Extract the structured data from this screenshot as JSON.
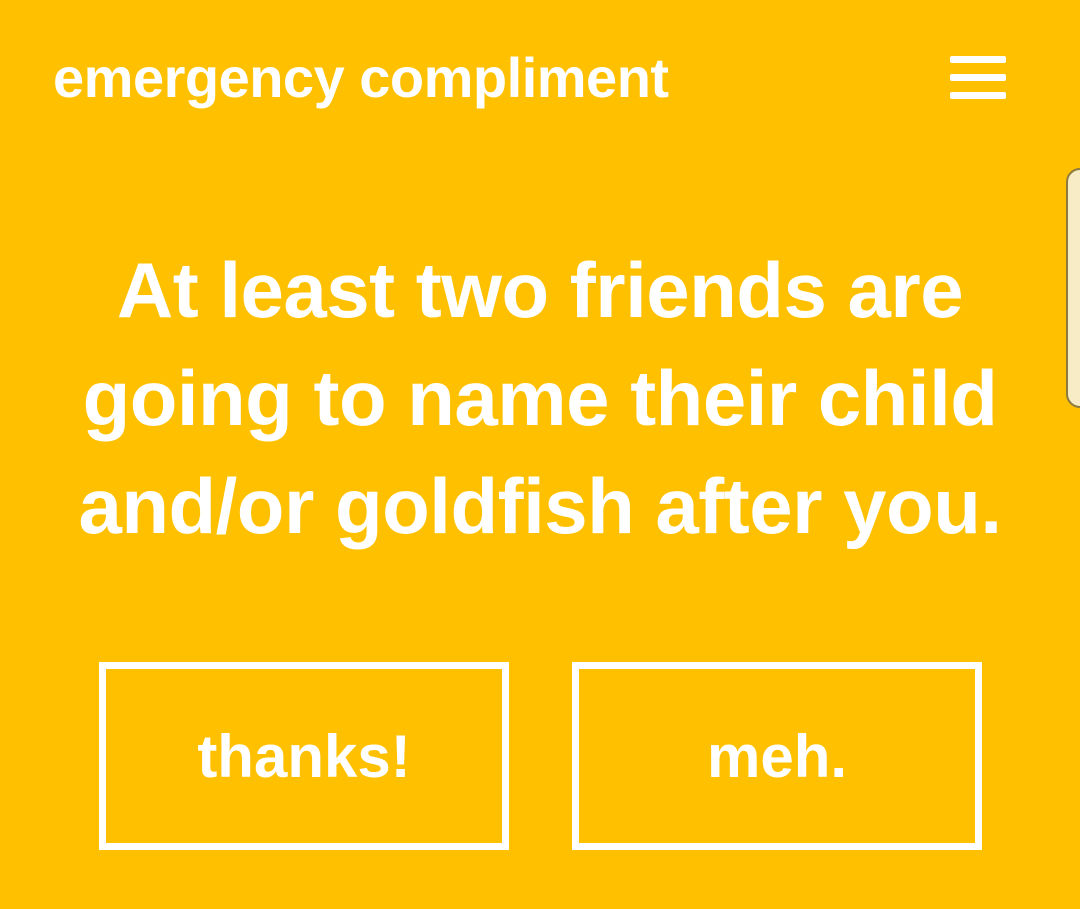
{
  "header": {
    "title": "emergency compliment",
    "menu_icon": "hamburger-menu-icon"
  },
  "main": {
    "compliment": "At least two friends are going to name their child and/or goldfish after you."
  },
  "responses": {
    "thanks_label": "thanks!",
    "meh_label": "meh."
  },
  "colors": {
    "background": "#FFC000",
    "foreground": "#FFFFFF"
  }
}
